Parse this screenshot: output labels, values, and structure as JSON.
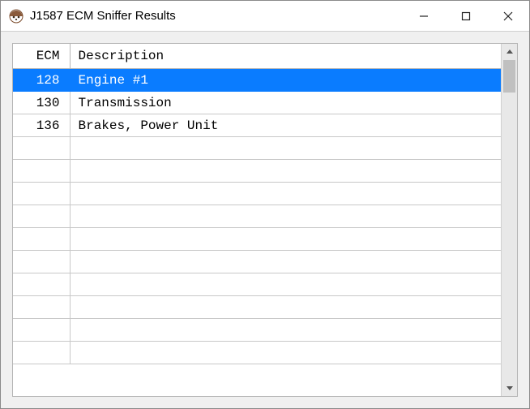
{
  "window": {
    "title": "J1587 ECM Sniffer Results"
  },
  "table": {
    "headers": {
      "ecm": "ECM",
      "description": "Description"
    },
    "rows": [
      {
        "ecm": "128",
        "description": "Engine #1",
        "selected": true
      },
      {
        "ecm": "130",
        "description": "Transmission",
        "selected": false
      },
      {
        "ecm": "136",
        "description": "Brakes, Power Unit",
        "selected": false
      }
    ],
    "empty_row_count": 10
  },
  "colors": {
    "selection": "#0a7cff"
  }
}
